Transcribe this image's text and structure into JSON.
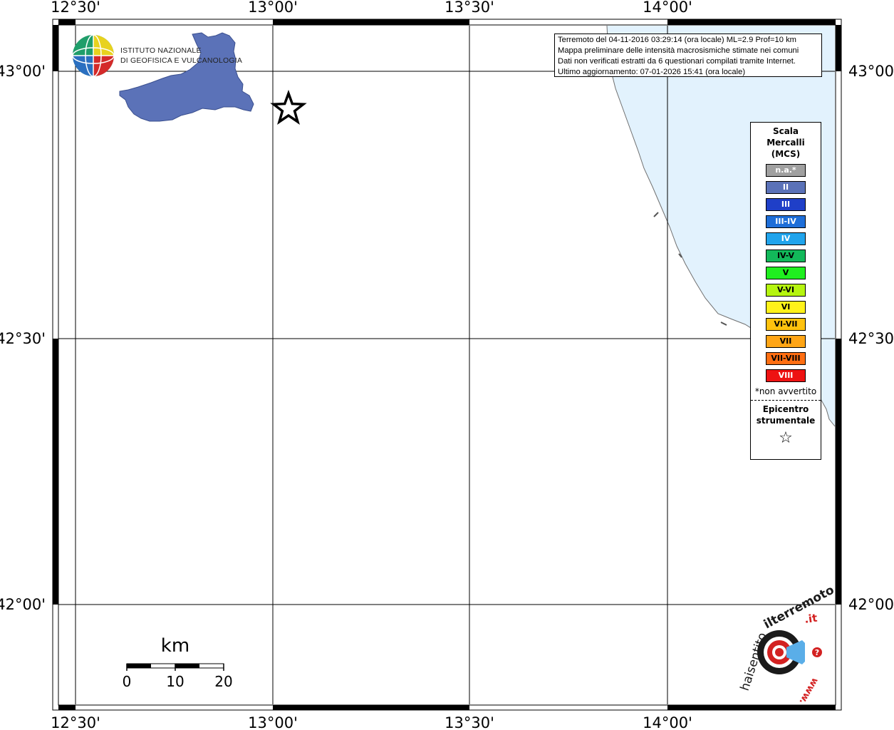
{
  "map": {
    "lon_labels": [
      "12°30'",
      "13°00'",
      "13°30'",
      "14°00'"
    ],
    "lat_labels": [
      "43°00'",
      "42°30'",
      "42°00'"
    ],
    "colors": {
      "sea": "#e2f2fd",
      "region_fill": "#5b72b8",
      "region_stroke": "#3a4f8e",
      "coast": "#707070"
    }
  },
  "info": {
    "line1": "Terremoto del 04-11-2016 03:29:14 (ora locale) ML=2.9 Prof=10 km",
    "line2": "Mappa preliminare delle intensità macrosismiche stimate nei comuni",
    "line3": "Dati non verificati estratti da 6 questionari compilati tramite Internet.",
    "line4": "Ultimo aggiornamento: 07-01-2026 15:41 (ora locale)"
  },
  "legend": {
    "title_line1": "Scala",
    "title_line2": "Mercalli",
    "title_line3": "(MCS)",
    "items": [
      {
        "label": "n.a.*",
        "color": "#a0a0a0",
        "text_color": "#ffffff"
      },
      {
        "label": "II",
        "color": "#5b72b8",
        "text_color": "#ffffff"
      },
      {
        "label": "III",
        "color": "#1f3fc8",
        "text_color": "#ffffff"
      },
      {
        "label": "III-IV",
        "color": "#1e6ed8",
        "text_color": "#ffffff"
      },
      {
        "label": "IV",
        "color": "#21a4ec",
        "text_color": "#ffffff"
      },
      {
        "label": "IV-V",
        "color": "#12b85a",
        "text_color": "#000000"
      },
      {
        "label": "V",
        "color": "#1fef1f",
        "text_color": "#000000"
      },
      {
        "label": "V-VI",
        "color": "#b5f50f",
        "text_color": "#000000"
      },
      {
        "label": "VI",
        "color": "#fff21a",
        "text_color": "#000000"
      },
      {
        "label": "VI-VII",
        "color": "#ffc20e",
        "text_color": "#000000"
      },
      {
        "label": "VII",
        "color": "#ffa515",
        "text_color": "#000000"
      },
      {
        "label": "VII-VIII",
        "color": "#ff6e12",
        "text_color": "#000000"
      },
      {
        "label": "VIII",
        "color": "#ee1212",
        "text_color": "#ffffff"
      }
    ],
    "note": "*non avvertito",
    "epi_line1": "Epicentro",
    "epi_line2": "strumentale",
    "epi_symbol": "☆"
  },
  "scale": {
    "unit": "km",
    "ticks": [
      "0",
      "10",
      "20"
    ]
  },
  "ingv": {
    "line1": "ISTITUTO NAZIONALE",
    "line2": "DI GEOFISICA E VULCANOLOGIA"
  },
  "hst": {
    "text_left": "haisentito",
    "text_mid": "ilterremoto",
    "text_end": ".it",
    "text_www": "www."
  }
}
